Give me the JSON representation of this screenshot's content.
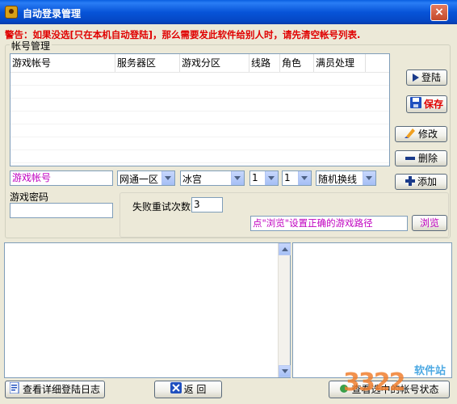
{
  "window": {
    "title": "自动登录管理",
    "close_glyph": "×"
  },
  "warning": "警告：如果没选[只在本机自动登陆]，那么需要发此软件给别人时，请先清空帐号列表.",
  "account_group": {
    "legend": "帐号管理",
    "columns": [
      "游戏帐号",
      "服务器区",
      "游戏分区",
      "线路",
      "角色",
      "满员处理"
    ]
  },
  "buttons": {
    "login": "登陆",
    "save": "保存",
    "modify": "修改",
    "delete": "删除",
    "add": "添加",
    "browse": "浏览",
    "view_log": "查看详细登陆日志",
    "back": "返 回",
    "view_selected": "查看选中的帐号状态"
  },
  "form": {
    "account_placeholder": "游戏帐号",
    "server_area": "网通一区",
    "game_zone": "冰宫",
    "line": "1",
    "role": "1",
    "full_handling": "随机换线",
    "password_label": "游戏密码",
    "password_value": "",
    "retry_label": "失败重试次数",
    "retry_value": "3",
    "path_hint": "点\"浏览\"设置正确的游戏路径"
  },
  "watermark": {
    "number": "3322",
    "text": "软件站"
  },
  "colors": {
    "accent_magenta": "#c000c0",
    "warning_red": "#e00000",
    "title_blue": "#0754d8"
  }
}
